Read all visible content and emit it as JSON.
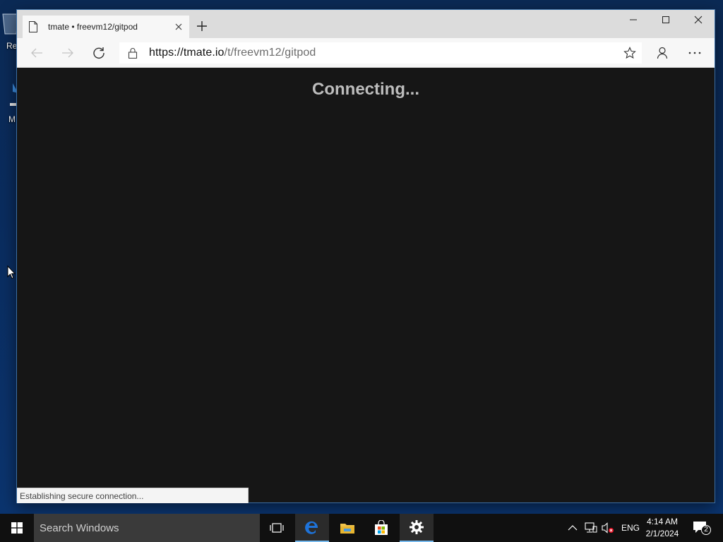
{
  "desktop": {
    "icon1_label": "Re",
    "icon2_label": "M"
  },
  "browser": {
    "tab": {
      "title": "tmate • freevm12/gitpod"
    },
    "address": {
      "scheme_host": "https://tmate.io",
      "path": "/t/freevm12/gitpod"
    },
    "page": {
      "message": "Connecting..."
    },
    "status": "Establishing secure connection..."
  },
  "taskbar": {
    "search_placeholder": "Search Windows",
    "tray": {
      "language": "ENG",
      "time": "4:14 AM",
      "date": "2/1/2024",
      "notification_count": "2"
    }
  },
  "colors": {
    "accent": "#76b9ed",
    "edge_blue": "#1e73d9",
    "page_bg": "#161616"
  }
}
